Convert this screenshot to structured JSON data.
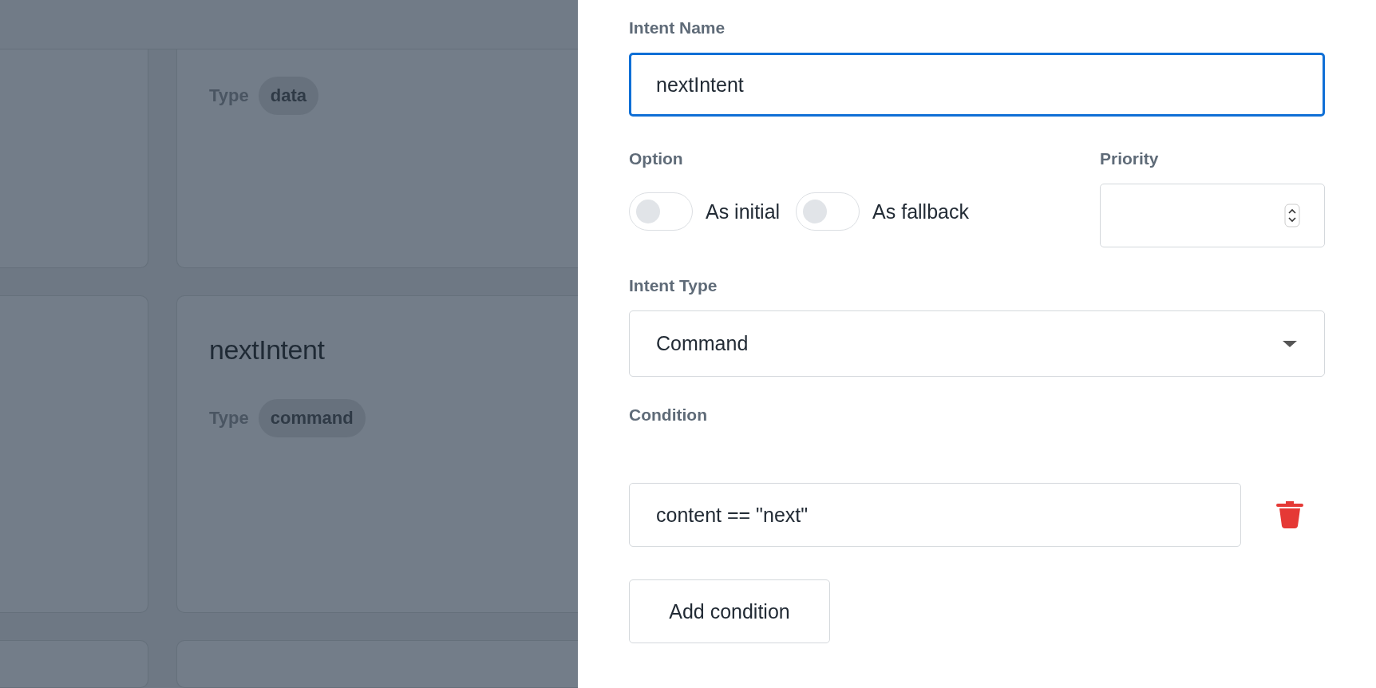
{
  "background": {
    "cards": [
      {
        "type_label": "Type",
        "type": "data"
      },
      {
        "title": "nextIntent",
        "type_label": "Type",
        "type": "command"
      }
    ]
  },
  "form": {
    "intent_name": {
      "label": "Intent Name",
      "value": "nextIntent",
      "focused": true
    },
    "option": {
      "label": "Option",
      "toggles": [
        {
          "label": "As initial",
          "on": false
        },
        {
          "label": "As fallback",
          "on": false
        }
      ]
    },
    "priority": {
      "label": "Priority"
    },
    "intent_type": {
      "label": "Intent Type",
      "value": "Command"
    },
    "condition": {
      "label": "Condition",
      "items": [
        {
          "value": "content == \"next\""
        }
      ],
      "add_button": "Add condition"
    }
  }
}
